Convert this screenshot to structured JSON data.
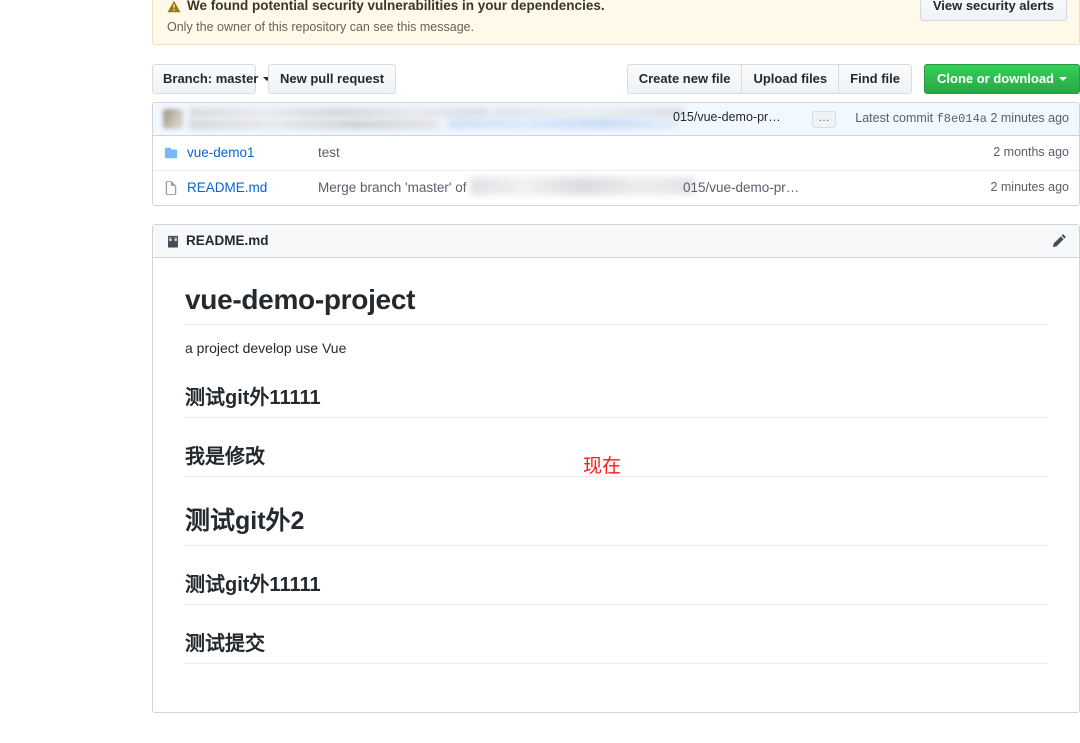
{
  "security_banner": {
    "icon": "alert-triangle-icon",
    "title": "We found potential security vulnerabilities in your dependencies.",
    "subtitle": "Only the owner of this repository can see this message.",
    "button_label": "View security alerts",
    "background_color": "#fff9ea"
  },
  "toolbar": {
    "branch_label": "Branch: master",
    "new_pull_request_label": "New pull request",
    "create_new_file_label": "Create new file",
    "upload_files_label": "Upload files",
    "find_file_label": "Find file",
    "clone_or_download_label": "Clone or download",
    "clone_button_color": "#28a745"
  },
  "commit_bar": {
    "message_tail": "015/vue-demo-pr…",
    "ellipsis_label": "…",
    "latest_commit_label": "Latest commit",
    "sha": "f8e014a",
    "time": "2 minutes ago",
    "background_color": "#f1f8ff"
  },
  "files": [
    {
      "icon": "folder-icon",
      "name": "vue-demo1",
      "message": "test",
      "message_tail": "",
      "has_blurred_message": false,
      "time": "2 months ago"
    },
    {
      "icon": "file-icon",
      "name": "README.md",
      "message": "Merge branch 'master' of",
      "message_tail": "015/vue-demo-pr…",
      "has_blurred_message": true,
      "time": "2 minutes ago"
    }
  ],
  "readme": {
    "icon": "book-icon",
    "title": "README.md",
    "edit_icon": "pencil-icon",
    "blocks": [
      {
        "type": "h1",
        "text": "vue-demo-project"
      },
      {
        "type": "p",
        "text": "a project develop use Vue"
      },
      {
        "type": "h3",
        "text": "测试git外11111"
      },
      {
        "type": "h3",
        "text": "我是修改"
      },
      {
        "type": "h2",
        "text": "测试git外2"
      },
      {
        "type": "h3",
        "text": "测试git外11111"
      },
      {
        "type": "h3",
        "text": "测试提交"
      }
    ]
  },
  "annotation": {
    "text": "现在",
    "color": "#ff1a1a"
  }
}
